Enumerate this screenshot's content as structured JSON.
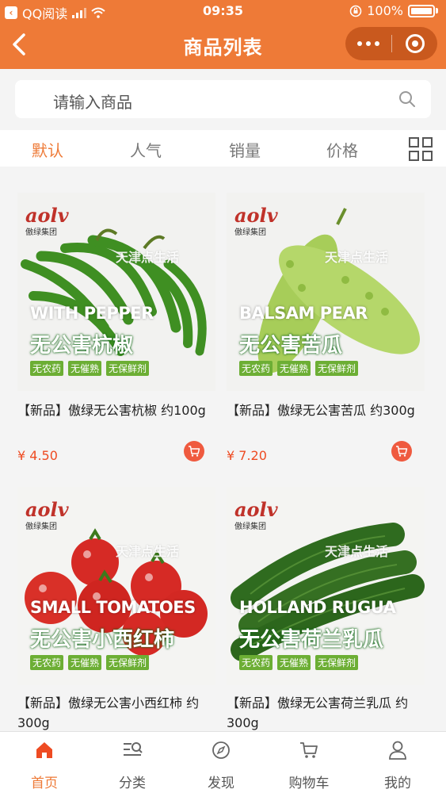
{
  "status_bar": {
    "app": "QQ阅读",
    "time": "09:35",
    "battery": "100%"
  },
  "header": {
    "title": "商品列表"
  },
  "search": {
    "placeholder": "请输入商品"
  },
  "sort_tabs": [
    {
      "label": "默认",
      "active": true
    },
    {
      "label": "人气",
      "active": false
    },
    {
      "label": "销量",
      "active": false
    },
    {
      "label": "价格",
      "active": false
    }
  ],
  "products": [
    {
      "name": "【新品】傲绿无公害杭椒 约100g",
      "price": "¥ 4.50",
      "image": {
        "brand_logo": "aolv",
        "brand_cn": "傲绿集团",
        "watermark": "天津点生活",
        "english": "WITH PEPPER",
        "chinese": "无公害杭椒",
        "tags": [
          "无农药",
          "无催熟",
          "无保鲜剂"
        ],
        "color": "#3f8f22"
      }
    },
    {
      "name": "【新品】傲绿无公害苦瓜 约300g",
      "price": "¥ 7.20",
      "image": {
        "brand_logo": "aolv",
        "brand_cn": "傲绿集团",
        "watermark": "天津点生活",
        "english": "BALSAM PEAR",
        "chinese": "无公害苦瓜",
        "tags": [
          "无农药",
          "无催熟",
          "无保鲜剂"
        ],
        "color": "#a7cd59"
      }
    },
    {
      "name": "【新品】傲绿无公害小西红柿 约300g",
      "price": "",
      "image": {
        "brand_logo": "aolv",
        "brand_cn": "傲绿集团",
        "watermark": "天津点生活",
        "english": "SMALL TOMATOES",
        "chinese": "无公害小西红柿",
        "tags": [
          "无农药",
          "无催熟",
          "无保鲜剂"
        ],
        "color": "#d62a25"
      }
    },
    {
      "name": "【新品】傲绿无公害荷兰乳瓜 约300g",
      "price": "",
      "image": {
        "brand_logo": "aolv",
        "brand_cn": "傲绿集团",
        "watermark": "天津点生活",
        "english": "HOLLAND RUGUA",
        "chinese": "无公害荷兰乳瓜",
        "tags": [
          "无农药",
          "无催熟",
          "无保鲜剂"
        ],
        "color": "#2f6b1f"
      }
    }
  ],
  "tabbar": [
    {
      "label": "首页",
      "icon": "home-icon",
      "active": true
    },
    {
      "label": "分类",
      "icon": "category-icon",
      "active": false
    },
    {
      "label": "发现",
      "icon": "compass-icon",
      "active": false
    },
    {
      "label": "购物车",
      "icon": "cart-icon",
      "active": false
    },
    {
      "label": "我的",
      "icon": "user-icon",
      "active": false
    }
  ],
  "colors": {
    "brand": "#ee7a37",
    "price": "#ee4b22"
  }
}
